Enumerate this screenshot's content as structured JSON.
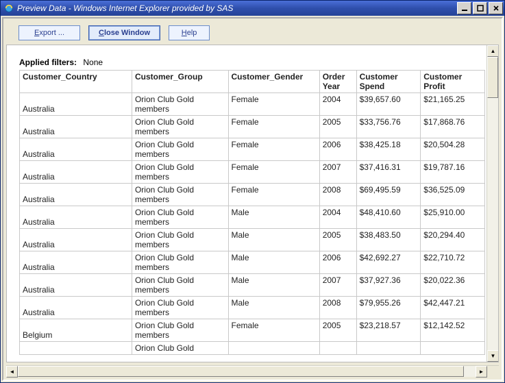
{
  "window": {
    "title": "Preview Data - Windows Internet Explorer provided by SAS"
  },
  "toolbar": {
    "export_label": "Export ...",
    "close_label": "Close Window",
    "help_label": "Help"
  },
  "filters": {
    "label": "Applied filters:",
    "value": "None"
  },
  "table": {
    "columns": [
      "Customer_Country",
      "Customer_Group",
      "Customer_Gender",
      "Order Year",
      "Customer Spend",
      "Customer Profit"
    ],
    "rows": [
      {
        "country": "Australia",
        "group": "Orion Club Gold members",
        "gender": "Female",
        "year": "2004",
        "spend": "$39,657.60",
        "profit": "$21,165.25"
      },
      {
        "country": "Australia",
        "group": "Orion Club Gold members",
        "gender": "Female",
        "year": "2005",
        "spend": "$33,756.76",
        "profit": "$17,868.76"
      },
      {
        "country": "Australia",
        "group": "Orion Club Gold members",
        "gender": "Female",
        "year": "2006",
        "spend": "$38,425.18",
        "profit": "$20,504.28"
      },
      {
        "country": "Australia",
        "group": "Orion Club Gold members",
        "gender": "Female",
        "year": "2007",
        "spend": "$37,416.31",
        "profit": "$19,787.16"
      },
      {
        "country": "Australia",
        "group": "Orion Club Gold members",
        "gender": "Female",
        "year": "2008",
        "spend": "$69,495.59",
        "profit": "$36,525.09"
      },
      {
        "country": "Australia",
        "group": "Orion Club Gold members",
        "gender": "Male",
        "year": "2004",
        "spend": "$48,410.60",
        "profit": "$25,910.00"
      },
      {
        "country": "Australia",
        "group": "Orion Club Gold members",
        "gender": "Male",
        "year": "2005",
        "spend": "$38,483.50",
        "profit": "$20,294.40"
      },
      {
        "country": "Australia",
        "group": "Orion Club Gold members",
        "gender": "Male",
        "year": "2006",
        "spend": "$42,692.27",
        "profit": "$22,710.72"
      },
      {
        "country": "Australia",
        "group": "Orion Club Gold members",
        "gender": "Male",
        "year": "2007",
        "spend": "$37,927.36",
        "profit": "$20,022.36"
      },
      {
        "country": "Australia",
        "group": "Orion Club Gold members",
        "gender": "Male",
        "year": "2008",
        "spend": "$79,955.26",
        "profit": "$42,447.21"
      },
      {
        "country": "Belgium",
        "group": "Orion Club Gold members",
        "gender": "Female",
        "year": "2005",
        "spend": "$23,218.57",
        "profit": "$12,142.52"
      },
      {
        "country": "",
        "group": "Orion Club Gold",
        "gender": "",
        "year": "",
        "spend": "",
        "profit": ""
      }
    ]
  }
}
